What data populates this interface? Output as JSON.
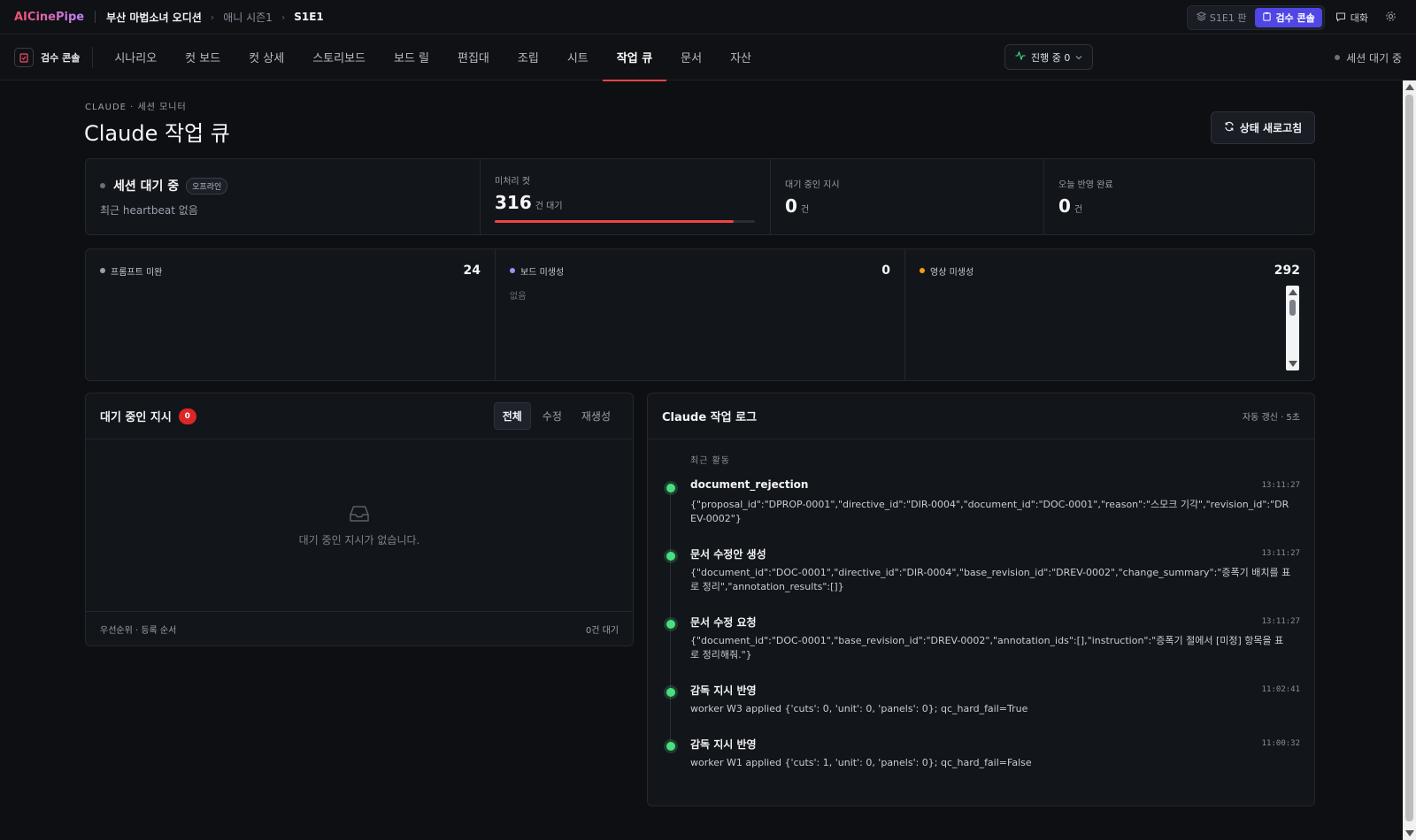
{
  "topbar": {
    "logo": "AICinePipe",
    "project": "부산 마법소녀 오디션",
    "season": "애니 시즌1",
    "episode": "S1E1",
    "version_label": "S1E1 판",
    "console_label": "검수 콘솔",
    "chat_label": "대화"
  },
  "nav": {
    "console_tag": "검수 콘솔",
    "tabs": [
      "시나리오",
      "컷 보드",
      "컷 상세",
      "스토리보드",
      "보드 릴",
      "편집대",
      "조립",
      "시트",
      "작업 큐",
      "문서",
      "자산"
    ],
    "active_tab": "작업 큐",
    "progress_label": "진행 중 0",
    "session_status": "세션 대기 중"
  },
  "header": {
    "eyebrow": "CLAUDE · 세션 모니터",
    "title": "Claude 작업 큐",
    "refresh_label": "상태 새로고침"
  },
  "stats": {
    "session_title": "세션 대기 중",
    "session_badge": "오프라인",
    "session_sub": "최근 heartbeat 없음",
    "pending_cuts_label": "미처리 컷",
    "pending_cuts_value": "316",
    "pending_cuts_unit": "건 대기",
    "pending_cuts_progress": 0.92,
    "waiting_directives_label": "대기 중인 지시",
    "waiting_directives_value": "0",
    "waiting_directives_unit": "건",
    "applied_today_label": "오늘 반영 완료",
    "applied_today_value": "0",
    "applied_today_unit": "건"
  },
  "queues": [
    {
      "label": "프롬프트 미완",
      "count": "24",
      "dot_color": "#9aa0ab",
      "empty": ""
    },
    {
      "label": "보드 미생성",
      "count": "0",
      "dot_color": "#a78bfa",
      "empty": "없음"
    },
    {
      "label": "영상 미생성",
      "count": "292",
      "dot_color": "#f59e0b",
      "empty": ""
    }
  ],
  "directives": {
    "title": "대기 중인 지시",
    "count": "0",
    "filters": [
      "전체",
      "수정",
      "재생성"
    ],
    "active_filter": "전체",
    "empty_text": "대기 중인 지시가 없습니다.",
    "footer_left": "우선순위 · 등록 순서",
    "footer_right": "0건 대기"
  },
  "log": {
    "title": "Claude 작업 로그",
    "auto_refresh": "자동 갱신 · 5초",
    "recent_label": "최근 활동",
    "entries": [
      {
        "title": "document_rejection",
        "time": "13:11:27",
        "text": "{\"proposal_id\":\"DPROP-0001\",\"directive_id\":\"DIR-0004\",\"document_id\":\"DOC-0001\",\"reason\":\"스모크 기각\",\"revision_id\":\"DREV-0002\"}"
      },
      {
        "title": "문서 수정안 생성",
        "time": "13:11:27",
        "text": "{\"document_id\":\"DOC-0001\",\"directive_id\":\"DIR-0004\",\"base_revision_id\":\"DREV-0002\",\"change_summary\":\"증폭기 배치를 표로 정리\",\"annotation_results\":[]}"
      },
      {
        "title": "문서 수정 요청",
        "time": "13:11:27",
        "text": "{\"document_id\":\"DOC-0001\",\"base_revision_id\":\"DREV-0002\",\"annotation_ids\":[],\"instruction\":\"증폭기 절에서 [미정] 항목을 표로 정리해줘.\"}"
      },
      {
        "title": "감독 지시 반영",
        "time": "11:02:41",
        "text": "worker W3 applied {'cuts': 0, 'unit': 0, 'panels': 0}; qc_hard_fail=True"
      },
      {
        "title": "감독 지시 반영",
        "time": "11:00:32",
        "text": "worker W1 applied {'cuts': 1, 'unit': 0, 'panels': 0}; qc_hard_fail=False"
      }
    ]
  },
  "colors": {
    "accent": "#4f46e5",
    "danger": "#ef4444",
    "success": "#4ade80"
  }
}
